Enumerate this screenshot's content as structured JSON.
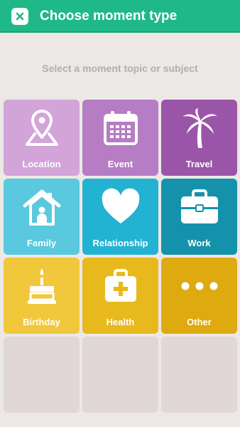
{
  "header": {
    "title": "Choose moment type",
    "close_icon": "close-icon",
    "color": "#1fb887"
  },
  "subtitle": "Select a moment topic or subject",
  "tiles": [
    {
      "label": "Location",
      "icon": "map-pin-icon",
      "color": "#d2a4d8"
    },
    {
      "label": "Event",
      "icon": "calendar-icon",
      "color": "#b67cc4"
    },
    {
      "label": "Travel",
      "icon": "palm-tree-icon",
      "color": "#9b55a8"
    },
    {
      "label": "Family",
      "icon": "house-icon",
      "color": "#5ac8de"
    },
    {
      "label": "Relationship",
      "icon": "heart-icon",
      "color": "#22b2d2"
    },
    {
      "label": "Work",
      "icon": "briefcase-icon",
      "color": "#1592ab"
    },
    {
      "label": "Birthday",
      "icon": "birthday-cake-icon",
      "color": "#f1c73c"
    },
    {
      "label": "Health",
      "icon": "first-aid-kit-icon",
      "color": "#e8b91c"
    },
    {
      "label": "Other",
      "icon": "more-icon",
      "color": "#deaa10"
    }
  ],
  "empty_tile_color": "#e0d7d6"
}
